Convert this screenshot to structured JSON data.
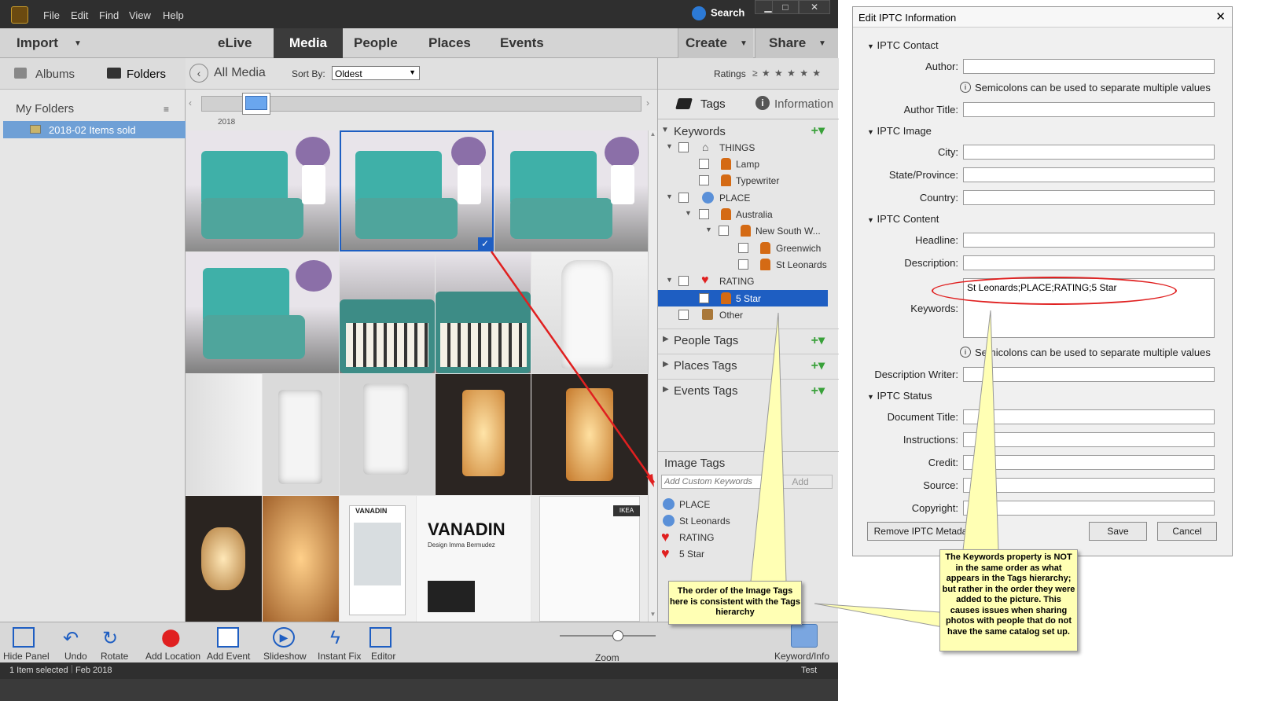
{
  "menubar": {
    "file": "File",
    "edit": "Edit",
    "find": "Find",
    "view": "View",
    "help": "Help",
    "search": "Search"
  },
  "tabs": {
    "import": "Import",
    "elive": "eLive",
    "media": "Media",
    "people": "People",
    "places": "Places",
    "events": "Events",
    "create": "Create",
    "share": "Share"
  },
  "left": {
    "albums": "Albums",
    "folders": "Folders",
    "my_folders": "My Folders",
    "folder_item": "2018-02 Items sold"
  },
  "toolbar": {
    "all_media": "All Media",
    "sort_by": "Sort By:",
    "sort_value": "Oldest",
    "ratings": "Ratings",
    "ratings_symbol": "≥ ★ ★ ★ ★ ★",
    "timeline_year": "2018"
  },
  "right": {
    "tags_tab": "Tags",
    "info_tab": "Information",
    "keywords": "Keywords",
    "things": "THINGS",
    "lamp": "Lamp",
    "typewriter": "Typewriter",
    "place": "PLACE",
    "australia": "Australia",
    "nsw": "New South W...",
    "greenwich": "Greenwich",
    "st_leonards": "St Leonards",
    "rating": "RATING",
    "five_star": "5 Star",
    "other": "Other",
    "people_tags": "People Tags",
    "places_tags": "Places Tags",
    "events_tags": "Events Tags",
    "image_tags": "Image Tags",
    "custom_placeholder": "Add Custom Keywords",
    "add": "Add",
    "applied": [
      "PLACE",
      "St Leonards",
      "RATING",
      "5 Star"
    ]
  },
  "bottom": {
    "hide_panel": "Hide Panel",
    "undo": "Undo",
    "rotate": "Rotate",
    "add_location": "Add Location",
    "add_event": "Add Event",
    "slideshow": "Slideshow",
    "instant_fix": "Instant Fix",
    "editor": "Editor",
    "zoom": "Zoom",
    "keyword_info": "Keyword/Info"
  },
  "status": {
    "selected": "1 Item selected",
    "date": "Feb 2018",
    "test": "Test"
  },
  "dialog": {
    "title": "Edit IPTC Information",
    "contact": "IPTC Contact",
    "author": "Author:",
    "semicolon_note": "Semicolons can be used to separate multiple values",
    "author_title": "Author Title:",
    "image": "IPTC Image",
    "city": "City:",
    "state": "State/Province:",
    "country": "Country:",
    "content": "IPTC Content",
    "headline": "Headline:",
    "description": "Description:",
    "keywords_label": "Keywords:",
    "keywords_value": "St Leonards;PLACE;RATING;5 Star",
    "desc_writer": "Description Writer:",
    "status": "IPTC Status",
    "doc_title": "Document Title:",
    "instructions": "Instructions:",
    "credit": "Credit:",
    "source": "Source:",
    "copyright": "Copyright:",
    "remove": "Remove IPTC Metadata",
    "save": "Save",
    "cancel": "Cancel"
  },
  "callouts": {
    "left": "The order of the Image Tags here is consistent with the Tags hierarchy",
    "right": "The Keywords property is NOT in the same order as what appears in the Tags hierarchy; but rather in the order they were added to the picture.  This causes issues when sharing photos with people that do not have the same catalog set up."
  },
  "colors": {
    "selection": "#1e5ec2",
    "accent_red": "#e02020",
    "tag_orange": "#d46a14",
    "callout_bg": "#ffffb4"
  }
}
